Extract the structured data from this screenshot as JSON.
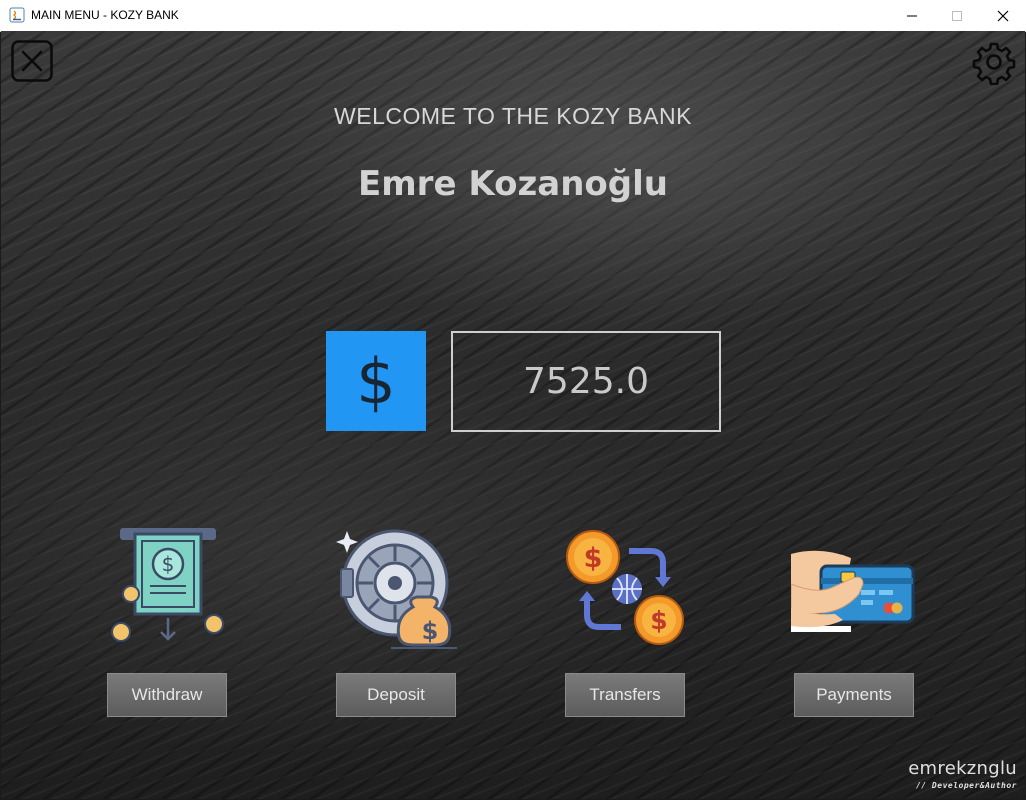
{
  "window": {
    "title": "MAIN MENU - KOZY BANK",
    "controls": {
      "minimize": "minimize-icon",
      "maximize": "maximize-icon",
      "close": "close-icon"
    }
  },
  "header": {
    "close_icon": "close-square-icon",
    "settings_icon": "gear-icon",
    "welcome": "WELCOME TO THE KOZY BANK",
    "user_name": "Emre Kozanoğlu"
  },
  "balance": {
    "currency_symbol": "$",
    "amount": "7525.0",
    "accent_color": "#2196f3"
  },
  "actions": [
    {
      "label": "Withdraw",
      "icon": "atm-withdraw-icon"
    },
    {
      "label": "Deposit",
      "icon": "vault-deposit-icon"
    },
    {
      "label": "Transfers",
      "icon": "currency-transfer-icon"
    },
    {
      "label": "Payments",
      "icon": "card-payment-icon"
    }
  ],
  "footer": {
    "brand_name": "emrekznglu",
    "brand_tag": "// Developer&Author"
  }
}
